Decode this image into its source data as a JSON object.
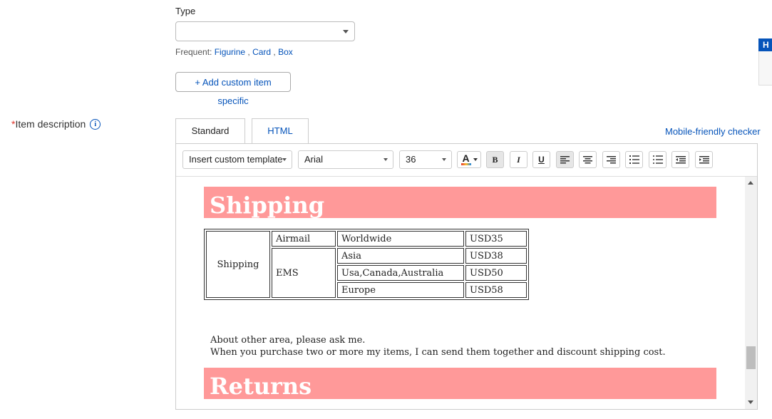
{
  "type_field": {
    "label": "Type",
    "value": "",
    "frequent_label": "Frequent: ",
    "frequent_options": [
      "Figurine",
      "Card",
      "Box"
    ],
    "separator": " , "
  },
  "add_custom_label": "+ Add custom item specific",
  "help_tab_label": "H",
  "description": {
    "required_mark": "*",
    "label": "Item description",
    "info_icon": "i"
  },
  "tabs": [
    {
      "label": "Standard",
      "active": true
    },
    {
      "label": "HTML",
      "active": false
    }
  ],
  "mobile_link": "Mobile-friendly checker",
  "toolbar": {
    "template_label": "Insert custom template",
    "font_family": "Arial",
    "font_size": "36",
    "text_color_icon": "A",
    "bold": "B",
    "italic": "I",
    "underline": "U",
    "icons": [
      "align-left-icon",
      "align-center-icon",
      "align-right-icon",
      "ordered-list-icon",
      "unordered-list-icon",
      "outdent-icon",
      "indent-icon"
    ]
  },
  "content": {
    "shipping_heading": "Shipping",
    "returns_heading": "Returns",
    "banner_color": "#ff9999",
    "table": {
      "row_header": "Shipping",
      "airmail": {
        "method": "Airmail",
        "region": "Worldwide",
        "price": "USD35"
      },
      "ems": {
        "method": "EMS",
        "rows": [
          {
            "region": "Asia",
            "price": "USD38"
          },
          {
            "region": "Usa,Canada,Australia",
            "price": "USD50"
          },
          {
            "region": "Europe",
            "price": "USD58"
          }
        ]
      }
    },
    "note_line1": "About other area, please ask me.",
    "note_line2": "When you purchase two or more my items, I can send them together and discount shipping cost."
  },
  "colors": {
    "link": "#0654ba",
    "required": "#e0362c"
  }
}
